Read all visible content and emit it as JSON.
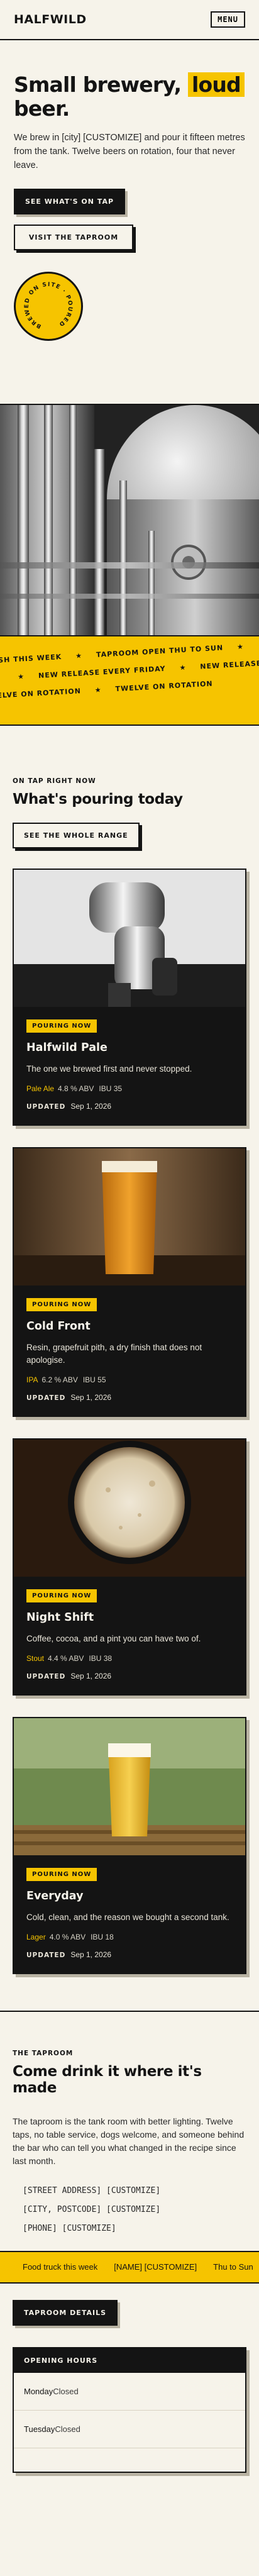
{
  "header": {
    "brand": "HALFWILD",
    "menu_label": "MENU"
  },
  "hero": {
    "title_pre": "Small brewery, ",
    "title_highlight": "loud",
    "title_post": " beer.",
    "text": "We brew in [city] [CUSTOMIZE] and pour it fifteen metres from the tank. Twelve beers on rotation, four that never leave.",
    "primary_cta": "SEE WHAT'S ON TAP",
    "secondary_cta": "VISIT THE TAPROOM",
    "badge_text": "BREWED ON SITE · POURED"
  },
  "ticker": {
    "rows": [
      [
        "FRESH THIS WEEK",
        "★",
        "TAPROOM OPEN THU TO SUN",
        "★"
      ],
      [
        "NEW RELEASE EVERY FRIDAY",
        "★",
        "NEW RELEASE EVERY FRIDAY"
      ],
      [
        "TWELVE ON ROTATION",
        "★",
        "TWELVE ON ROTATION"
      ]
    ]
  },
  "pouring": {
    "eyebrow": "ON TAP RIGHT NOW",
    "title": "What's pouring today",
    "cta": "SEE THE WHOLE RANGE",
    "updated_label": "UPDATED",
    "cards": [
      {
        "badge": "POURING NOW",
        "name": "Halfwild Pale",
        "desc": "The one we brewed first and never stopped.",
        "style": "Pale Ale",
        "abv": "4.8 % ABV",
        "ibu": "IBU 35",
        "updated": "Sep 1, 2026"
      },
      {
        "badge": "POURING NOW",
        "name": "Cold Front",
        "desc": "Resin, grapefruit pith, a dry finish that does not apologise.",
        "style": "IPA",
        "abv": "6.2 % ABV",
        "ibu": "IBU 55",
        "updated": "Sep 1, 2026"
      },
      {
        "badge": "POURING NOW",
        "name": "Night Shift",
        "desc": "Coffee, cocoa, and a pint you can have two of.",
        "style": "Stout",
        "abv": "4.4 % ABV",
        "ibu": "IBU 38",
        "updated": "Sep 1, 2026"
      },
      {
        "badge": "POURING NOW",
        "name": "Everyday",
        "desc": "Cold, clean, and the reason we bought a second tank.",
        "style": "Lager",
        "abv": "4.0 % ABV",
        "ibu": "IBU 18",
        "updated": "Sep 1, 2026"
      }
    ]
  },
  "taproom": {
    "eyebrow": "THE TAPROOM",
    "title": "Come drink it where it's made",
    "text": "The taproom is the tank room with better lighting. Twelve taps, no table service, dogs welcome, and someone behind the bar who can tell you what changed in the recipe since last month.",
    "address": [
      "[STREET ADDRESS] [CUSTOMIZE]",
      "[CITY, POSTCODE] [CUSTOMIZE]",
      "[PHONE] [CUSTOMIZE]"
    ],
    "food_truck": [
      "Food truck this week",
      "[NAME] [CUSTOMIZE]",
      "Thu to Sun"
    ],
    "cta": "TAPROOM DETAILS",
    "hours_title": "OPENING HOURS",
    "hours": [
      {
        "day": "Monday",
        "value": "Closed"
      },
      {
        "day": "Tuesday",
        "value": "Closed"
      }
    ]
  },
  "colors": {
    "accent": "#f6c400",
    "ink": "#141414",
    "paper": "#f6f3ea"
  }
}
